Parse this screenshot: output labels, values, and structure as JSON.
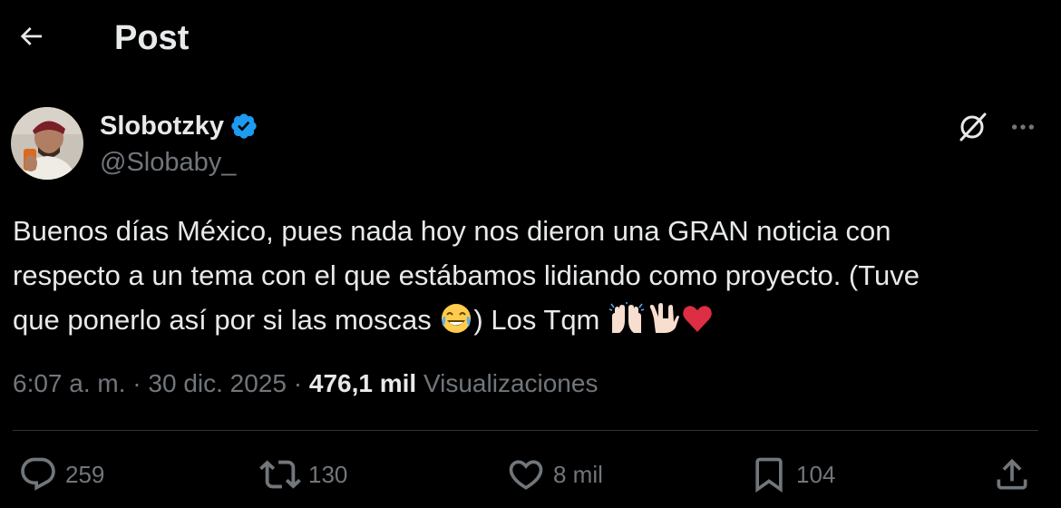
{
  "header": {
    "back_icon": "arrow-left-icon",
    "title": "Post"
  },
  "author": {
    "name": "Slobotzky",
    "handle": "@Slobaby_",
    "verified": true,
    "verified_color": "#1d9bf0"
  },
  "post": {
    "text_lines": [
      "Buenos días México, pues nada hoy nos dieron una GRAN noticia con",
      "respecto a un tema con el que estábamos lidiando como proyecto. (Tuve"
    ],
    "line3_part1": "que ponerlo así por si las moscas ",
    "line3_part2": ") Los Tqm ",
    "emojis": [
      "joy-emoji",
      "raising-hands-emoji",
      "love-you-gesture-emoji",
      "red-heart-emoji"
    ],
    "time": "6:07 a. m.",
    "separator": "·",
    "date": "30 dic. 2025",
    "views_count": "476,1 mil",
    "views_label": "Visualizaciones"
  },
  "actions": {
    "replies": "259",
    "reposts": "130",
    "likes": "8 mil",
    "bookmarks": "104"
  },
  "colors": {
    "background": "#000000",
    "text_primary": "#e7e9ea",
    "text_secondary": "#71767b",
    "divider": "#2f3336",
    "accent": "#1d9bf0"
  }
}
